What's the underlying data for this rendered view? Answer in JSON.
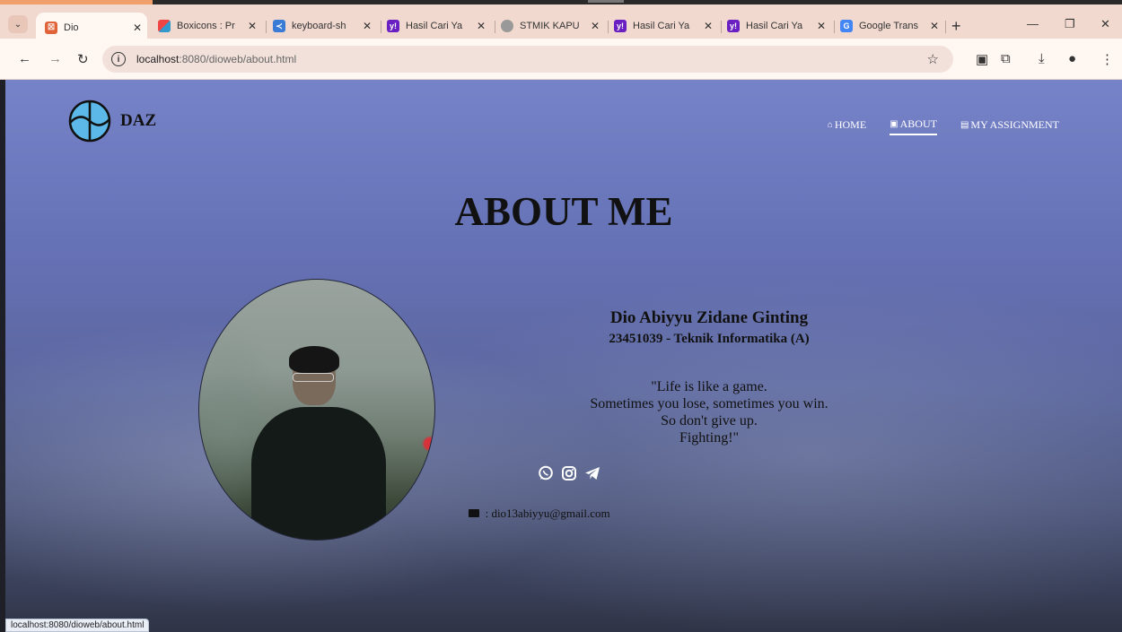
{
  "browser": {
    "tabs": [
      {
        "title": "Dio",
        "active": true
      },
      {
        "title": "Boxicons : Pr"
      },
      {
        "title": "keyboard-sh"
      },
      {
        "title": "Hasil Cari Ya"
      },
      {
        "title": "STMIK KAPU"
      },
      {
        "title": "Hasil Cari Ya"
      },
      {
        "title": "Hasil Cari Ya"
      },
      {
        "title": "Google Trans"
      }
    ],
    "url_host": "localhost",
    "url_rest": ":8080/dioweb/about.html",
    "status_url": "localhost:8080/dioweb/about.html"
  },
  "site": {
    "logo_text": "DAZ",
    "nav": [
      {
        "label": "HOME",
        "icon": "home-icon"
      },
      {
        "label": "ABOUT",
        "icon": "user-badge-icon",
        "active": true
      },
      {
        "label": "MY ASSIGNMENT",
        "icon": "clipboard-icon"
      }
    ]
  },
  "about": {
    "heading": "ABOUT ME",
    "name": "Dio Abiyyu Zidane Ginting",
    "id_line": "23451039 - Teknik Informatika (A)",
    "quote_lines": [
      "\"Life is like a game.",
      "Sometimes you lose, sometimes you win.",
      "So don't give up.",
      "Fighting!\""
    ],
    "socials": [
      "whatsapp-icon",
      "instagram-icon",
      "telegram-icon"
    ],
    "email_text": " : dio13abiyyu@gmail.com"
  }
}
